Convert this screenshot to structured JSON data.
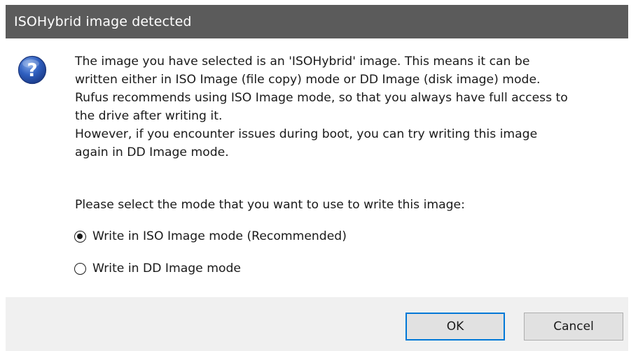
{
  "window": {
    "title": "ISOHybrid image detected"
  },
  "dialog": {
    "icon": "question-icon",
    "message_lines": [
      "The image you have selected is an 'ISOHybrid' image. This means it can be",
      "written either in ISO Image (file copy) mode or DD Image (disk image) mode.",
      "Rufus recommends using ISO Image mode, so that you always have full access to",
      "the drive after writing it.",
      "However, if you encounter issues during boot, you can try writing this image",
      "again in DD Image mode."
    ],
    "prompt": "Please select the mode that you want to use to write this image:",
    "options": [
      {
        "label": "Write in ISO Image mode (Recommended)",
        "selected": true
      },
      {
        "label": "Write in DD Image mode",
        "selected": false
      }
    ]
  },
  "buttons": {
    "ok_label": "OK",
    "cancel_label": "Cancel"
  },
  "colors": {
    "titlebar": "#5b5b5b",
    "footer": "#f0f0f0",
    "accent": "#0078d7",
    "icon_blue": "#2a5bb5"
  }
}
